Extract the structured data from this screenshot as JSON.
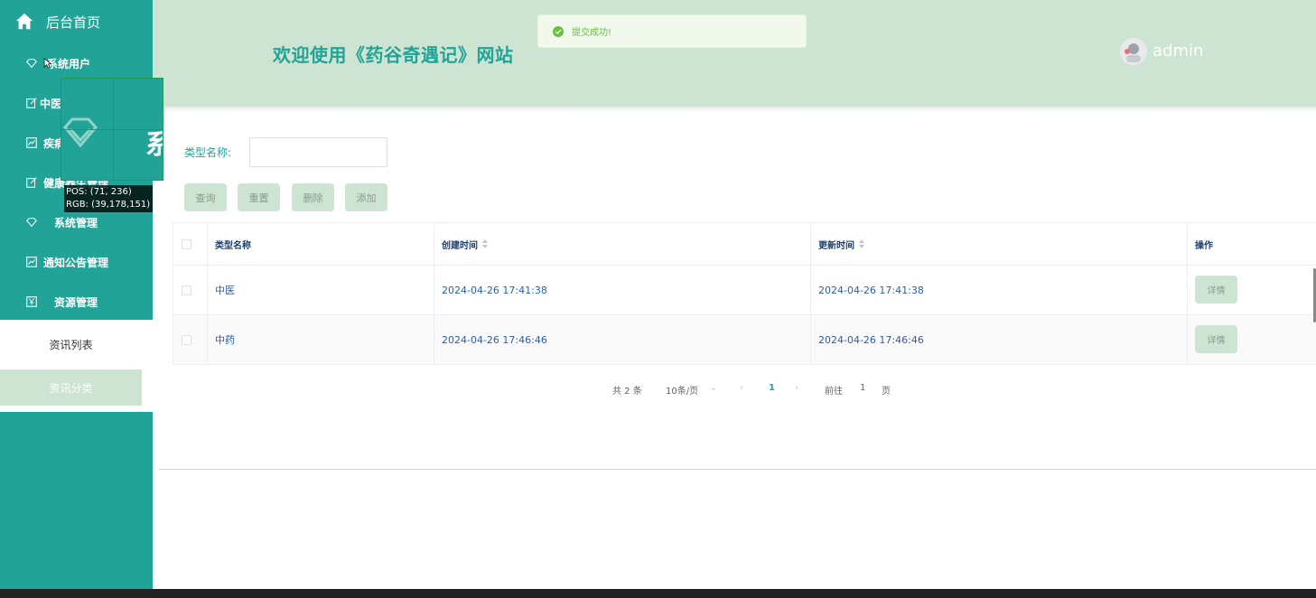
{
  "sidebar": {
    "home_label": "后台首页",
    "items": [
      {
        "label": "系统用户",
        "icon": "diamond-icon"
      },
      {
        "label": "中医",
        "icon": "edit-icon"
      },
      {
        "label": "疾病",
        "icon": "chart-icon"
      },
      {
        "label": "健康养生管理",
        "icon": "edit-icon"
      },
      {
        "label": "系统管理",
        "icon": "diamond-icon"
      },
      {
        "label": "通知公告管理",
        "icon": "chart-icon"
      },
      {
        "label": "资源管理",
        "icon": "yen-icon"
      }
    ],
    "subitems": [
      {
        "label": "资讯列表",
        "state": "normal"
      },
      {
        "label": "资讯分类",
        "state": "active"
      }
    ]
  },
  "header": {
    "title": "欢迎使用《药谷奇遇记》网站",
    "username": "admin"
  },
  "toast": {
    "message": "提交成功!"
  },
  "search": {
    "label": "类型名称:",
    "value": "",
    "placeholder": ""
  },
  "buttons": {
    "query": "查询",
    "reset": "重置",
    "delete": "删除",
    "add": "添加"
  },
  "table": {
    "columns": [
      "类型名称",
      "创建时间",
      "更新时间",
      "操作"
    ],
    "rows": [
      {
        "name": "中医",
        "created": "2024-04-26 17:41:38",
        "updated": "2024-04-26 17:41:38",
        "action": "详情"
      },
      {
        "name": "中药",
        "created": "2024-04-26 17:46:46",
        "updated": "2024-04-26 17:46:46",
        "action": "详情"
      }
    ]
  },
  "pagination": {
    "total": "共 2 条",
    "page_size": "10条/页",
    "current_page": "1",
    "goto_label": "前往",
    "goto_value": "1",
    "page_suffix": "页"
  },
  "magnifier": {
    "glyph": "系",
    "pos": "POS:  (71, 236)",
    "rgb": "RGB:  (39,178,151)"
  },
  "colors": {
    "sidebar": "#21a497",
    "header": "#cde4d2",
    "accent": "#21a497",
    "success": "#67c23a"
  }
}
